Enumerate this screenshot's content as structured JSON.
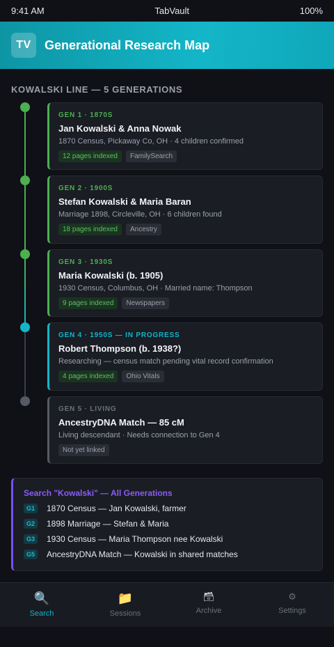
{
  "status": {
    "time": "9:41 AM",
    "app": "TabVault",
    "battery": "100%"
  },
  "header": {
    "badge": "TV",
    "title": "Generational Research Map"
  },
  "section_title": "KOWALSKI LINE — 5 GENERATIONS",
  "colors": {
    "complete": "#4caf50",
    "in_progress": "#13b6c8",
    "unlinked": "#555a63",
    "search_accent": "#7c4dff"
  },
  "generations": [
    {
      "tag": "GEN 1 · 1870S",
      "name": "Jan Kowalski & Anna Nowak",
      "detail": "1870 Census, Pickaway Co, OH · 4 children confirmed",
      "pages": "12 pages indexed",
      "source": "FamilySearch",
      "state": "complete"
    },
    {
      "tag": "GEN 2 · 1900S",
      "name": "Stefan Kowalski & Maria Baran",
      "detail": "Marriage 1898, Circleville, OH · 6 children found",
      "pages": "18 pages indexed",
      "source": "Ancestry",
      "state": "complete"
    },
    {
      "tag": "GEN 3 · 1930S",
      "name": "Maria Kowalski (b. 1905)",
      "detail": "1930 Census, Columbus, OH · Married name: Thompson",
      "pages": "9 pages indexed",
      "source": "Newspapers",
      "state": "complete"
    },
    {
      "tag": "GEN 4 · 1950S — IN PROGRESS",
      "name": "Robert Thompson (b. 1938?)",
      "detail": "Researching — census match pending vital record confirmation",
      "pages": "4 pages indexed",
      "source": "Ohio Vitals",
      "state": "in_progress"
    },
    {
      "tag": "GEN 5 · LIVING",
      "name": "AncestryDNA Match — 85 cM",
      "detail": "Living descendant · Needs connection to Gen 4",
      "status_chip": "Not yet linked",
      "state": "unlinked"
    }
  ],
  "search": {
    "title": "Search \"Kowalski\" — All Generations",
    "results": [
      {
        "gen": "G1",
        "text": "1870 Census — Jan Kowalski, farmer"
      },
      {
        "gen": "G2",
        "text": "1898 Marriage — Stefan & Maria"
      },
      {
        "gen": "G3",
        "text": "1930 Census — Maria Thompson nee Kowalski"
      },
      {
        "gen": "G5",
        "text": "AncestryDNA Match — Kowalski in shared matches"
      }
    ]
  },
  "tabs": [
    {
      "label": "Search",
      "icon": "magnifier-icon",
      "glyph": "🔍",
      "active": true
    },
    {
      "label": "Sessions",
      "icon": "folder-icon",
      "glyph": "📁",
      "active": false
    },
    {
      "label": "Archive",
      "icon": "archive-box-icon",
      "glyph": "🗃",
      "active": false
    },
    {
      "label": "Settings",
      "icon": "gear-icon",
      "glyph": "⚙",
      "active": false
    }
  ]
}
